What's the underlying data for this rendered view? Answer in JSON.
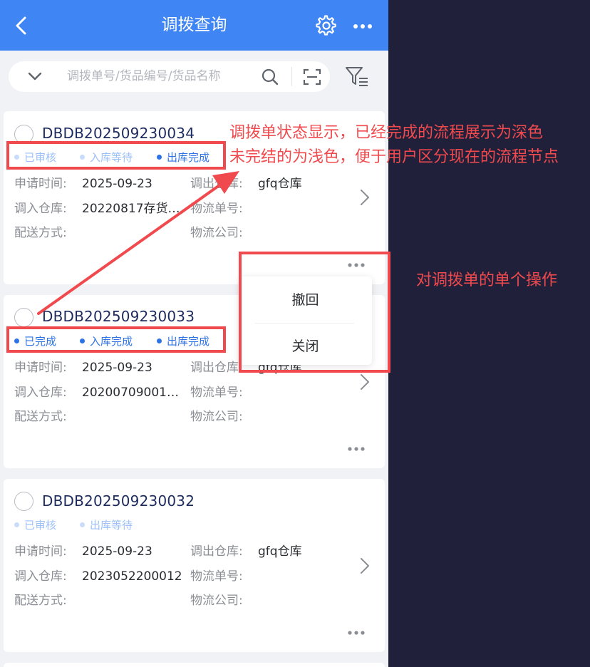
{
  "header": {
    "title": "调拨查询",
    "back_icon": "chevron-left-icon",
    "settings_icon": "gear-icon",
    "more_icon": "more-horizontal-icon",
    "color": "#3f85f4"
  },
  "search": {
    "placeholder": "调拨单号/货品编号/货品名称",
    "dropdown_icon": "chevron-down-icon",
    "search_icon": "search-icon",
    "scan_icon": "scan-icon",
    "filter_icon": "filter-icon"
  },
  "labels": {
    "apply_time": "申请时间:",
    "out_warehouse": "调出仓库:",
    "in_warehouse": "调入仓库:",
    "logistics_no": "物流单号:",
    "delivery": "配送方式:",
    "logistics_company": "物流公司:"
  },
  "orders": [
    {
      "no": "DBDB202509230034",
      "statuses": [
        {
          "text": "已审核",
          "state": "light"
        },
        {
          "text": "入库等待",
          "state": "light"
        },
        {
          "text": "出库完成",
          "state": "dark"
        }
      ],
      "apply_time": "2025-09-23",
      "out_warehouse": "gfq仓库",
      "in_warehouse": "20220817存货…",
      "logistics_no": "",
      "delivery": "",
      "logistics_company": ""
    },
    {
      "no": "DBDB202509230033",
      "statuses": [
        {
          "text": "已完成",
          "state": "dark"
        },
        {
          "text": "入库完成",
          "state": "dark"
        },
        {
          "text": "出库完成",
          "state": "dark"
        }
      ],
      "apply_time": "2025-09-23",
      "out_warehouse": "gfq仓库",
      "in_warehouse": "20200709001…",
      "logistics_no": "",
      "delivery": "",
      "logistics_company": ""
    },
    {
      "no": "DBDB202509230032",
      "statuses": [
        {
          "text": "已审核",
          "state": "light"
        },
        {
          "text": "出库等待",
          "state": "light"
        }
      ],
      "apply_time": "2025-09-23",
      "out_warehouse": "gfq仓库",
      "in_warehouse": "2023052200012",
      "logistics_no": "",
      "delivery": "",
      "logistics_company": ""
    }
  ],
  "popup": {
    "items": [
      "撤回",
      "关闭"
    ]
  },
  "annotations": {
    "status_note_line1": "调拨单状态显示，已经完成的流程展示为深色",
    "status_note_line2": "未完结的为浅色，便于用户区分现在的流程节点",
    "action_note": "对调拨单的单个操作",
    "color": "#f04a4e"
  }
}
